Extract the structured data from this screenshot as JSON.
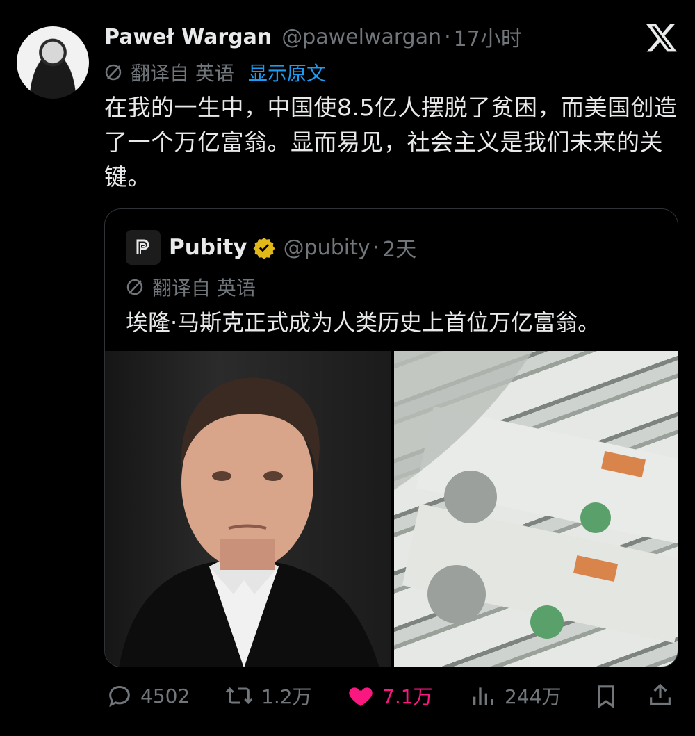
{
  "tweet": {
    "author_name": "Paweł Wargan",
    "author_handle": "@pawelwargan",
    "separator": "·",
    "time": "17小时",
    "translated_from": "翻译自 英语",
    "show_original": "显示原文",
    "text": "在我的一生中，中国使8.5亿人摆脱了贫困，而美国创造了一个万亿富翁。显而易见，社会主义是我们未来的关键。"
  },
  "quote": {
    "author_name": "Pubity",
    "author_handle": "@pubity",
    "separator": "·",
    "time": "2天",
    "translated_from": "翻译自 英语",
    "text": "埃隆·马斯克正式成为人类历史上首位万亿富翁。"
  },
  "actions": {
    "replies": "4502",
    "retweets": "1.2万",
    "likes": "7.1万",
    "views": "244万"
  },
  "colors": {
    "background": "#000000",
    "text": "#e7e9ea",
    "muted": "#71767b",
    "link": "#1d9bf0",
    "like": "#f91880",
    "verified_gold": "#e2b719"
  },
  "icons": [
    "x-logo-icon",
    "translate-icon",
    "pubity-logo-icon",
    "verified-badge-icon",
    "reply-icon",
    "retweet-icon",
    "like-icon",
    "views-icon",
    "bookmark-icon",
    "share-icon"
  ]
}
